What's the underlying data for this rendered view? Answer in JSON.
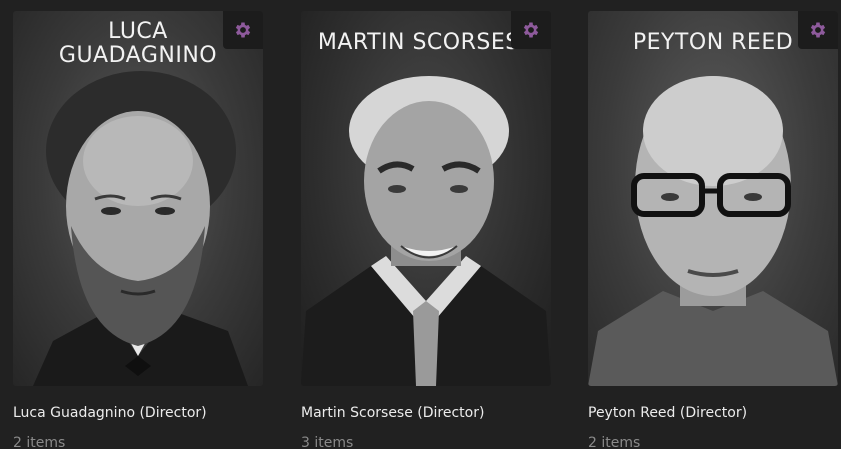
{
  "accent_color": "#8e5a9c",
  "cards": [
    {
      "poster_title": "LUCA\nGUADAGNINO",
      "name": "Luca Guadagnino (Director)",
      "count": "2 items",
      "settings_icon": "gear-icon"
    },
    {
      "poster_title": "MARTIN SCORSESE",
      "name": "Martin Scorsese (Director)",
      "count": "3 items",
      "settings_icon": "gear-icon"
    },
    {
      "poster_title": "PEYTON REED",
      "name": "Peyton Reed (Director)",
      "count": "2 items",
      "settings_icon": "gear-icon"
    }
  ]
}
